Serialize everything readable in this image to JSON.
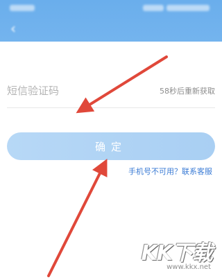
{
  "header": {
    "title": "",
    "background_color": "#6aaeec"
  },
  "form": {
    "phone_masked": "",
    "code_placeholder": "短信验证码",
    "resend_countdown": "58秒后重新获取"
  },
  "confirm_button": {
    "label": "确定",
    "color": "#b1d4f4"
  },
  "help": {
    "phone_unavailable": "手机号不可用？",
    "contact_service": "联系客服"
  },
  "annotation": {
    "arrow_color": "#e0483a"
  },
  "watermark": {
    "brand": "KK下载",
    "url": "www.kkx.net"
  }
}
